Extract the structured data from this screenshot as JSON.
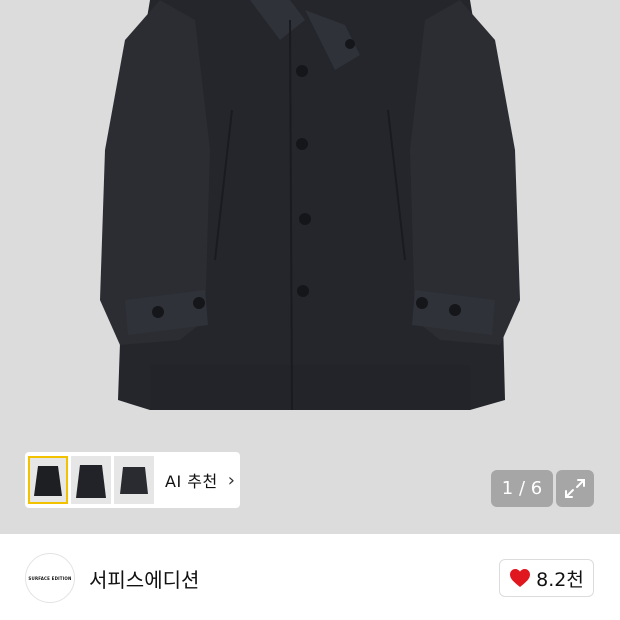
{
  "gallery": {
    "counter": "1 / 6",
    "background": "#dcdcdc"
  },
  "ai_recommend": {
    "label": "AI 추천",
    "chevron": "›",
    "thumbnail_count": 3
  },
  "icons": {
    "expand": "expand-icon",
    "heart": "heart-icon",
    "chevron": "chevron-right-icon"
  },
  "brand": {
    "name": "서피스에디션",
    "logo_text": "SURFACE EDITION"
  },
  "like": {
    "count": "8.2천",
    "color": "#e0171f"
  }
}
